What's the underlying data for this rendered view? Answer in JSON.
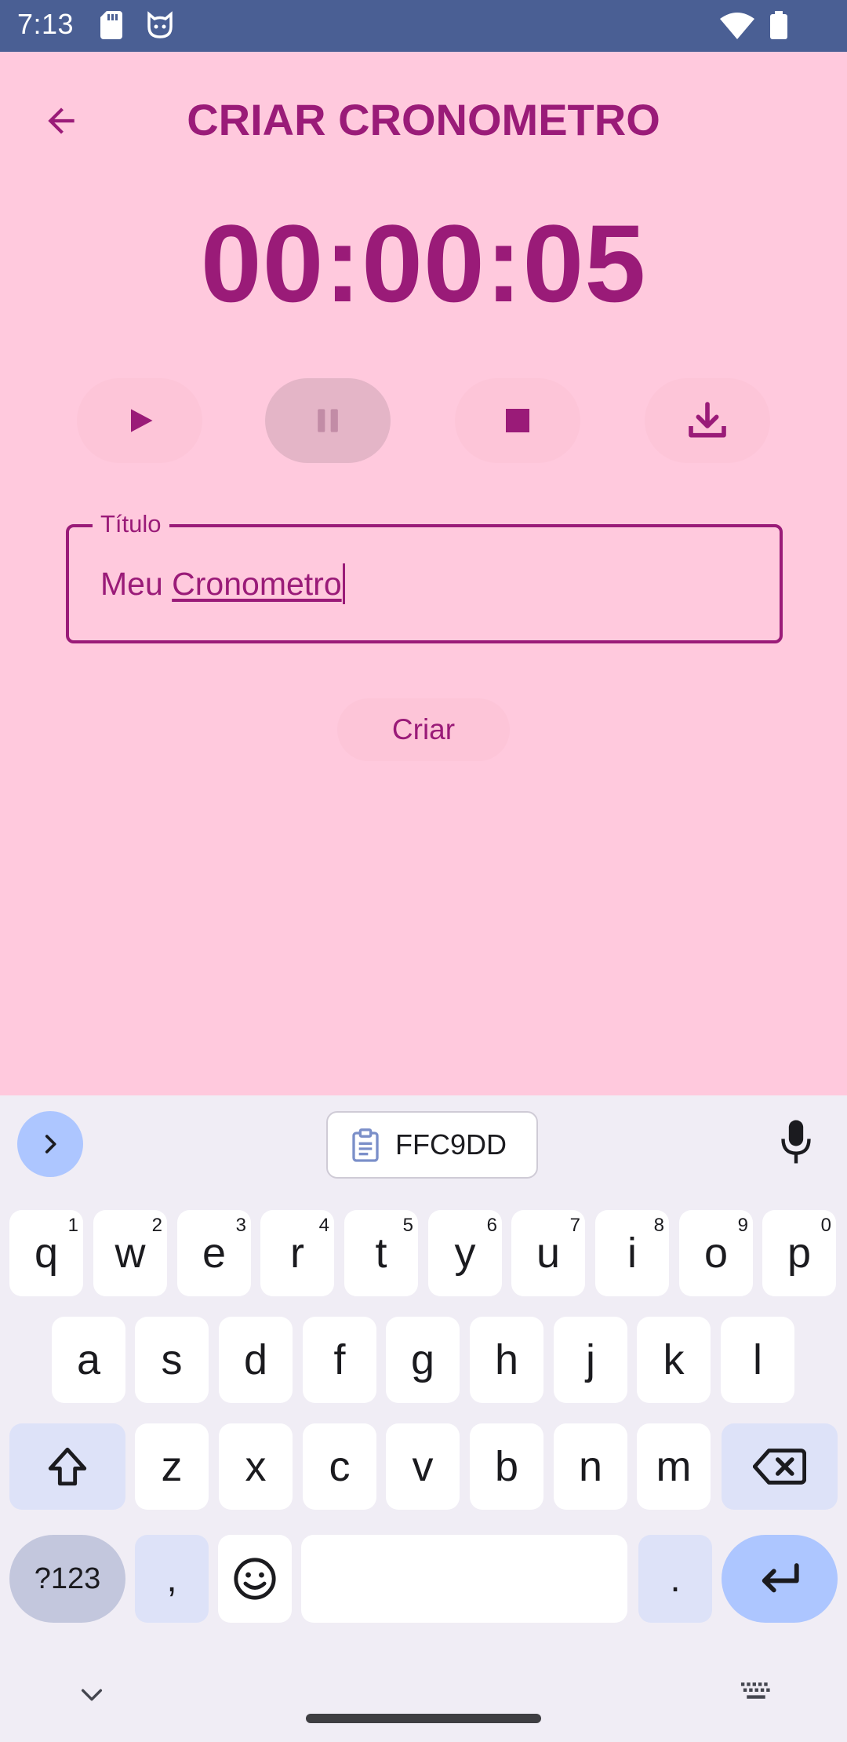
{
  "status_bar": {
    "time": "7:13",
    "icons": [
      "sd-card-icon",
      "cat-icon",
      "wifi-icon",
      "battery-icon"
    ]
  },
  "app_bar": {
    "title": "CRIAR CRONOMETRO",
    "back_icon": "arrow-back-icon"
  },
  "timer": {
    "display": "00:00:05"
  },
  "controls": {
    "buttons": [
      "play-icon",
      "pause-icon",
      "stop-icon",
      "download-icon"
    ]
  },
  "title_field": {
    "label": "Título",
    "value_prefix": "Meu ",
    "value_underlined": "Cronometro"
  },
  "actions": {
    "create_label": "Criar"
  },
  "keyboard": {
    "clipboard_text": "FFC9DD",
    "row1": [
      {
        "key": "q",
        "hint": "1"
      },
      {
        "key": "w",
        "hint": "2"
      },
      {
        "key": "e",
        "hint": "3"
      },
      {
        "key": "r",
        "hint": "4"
      },
      {
        "key": "t",
        "hint": "5"
      },
      {
        "key": "y",
        "hint": "6"
      },
      {
        "key": "u",
        "hint": "7"
      },
      {
        "key": "i",
        "hint": "8"
      },
      {
        "key": "o",
        "hint": "9"
      },
      {
        "key": "p",
        "hint": "0"
      }
    ],
    "row2": [
      "a",
      "s",
      "d",
      "f",
      "g",
      "h",
      "j",
      "k",
      "l"
    ],
    "row3": [
      "z",
      "x",
      "c",
      "v",
      "b",
      "n",
      "m"
    ],
    "symbols_label": "?123",
    "comma": ",",
    "period": "."
  },
  "colors": {
    "background": "#FFC9DD",
    "accent": "#9A1B78",
    "status_bar": "#4A5F94",
    "keyboard_bg": "#F0EDF5"
  }
}
